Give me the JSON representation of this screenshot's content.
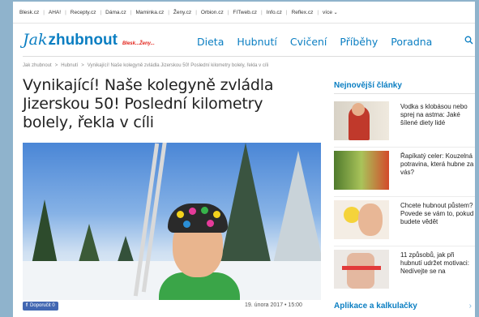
{
  "portal_links": [
    "Blesk.cz",
    "AHA!",
    "Recepty.cz",
    "Dáma.cz",
    "Maminka.cz",
    "Ženy.cz",
    "Orbion.cz",
    "FITweb.cz",
    "Info.cz",
    "Reflex.cz",
    "více"
  ],
  "logo": {
    "jak": "Jak",
    "zhubnout": "zhubnout",
    "tag": "Blesk...Ženy..."
  },
  "nav": [
    "Dieta",
    "Hubnutí",
    "Cvičení",
    "Příběhy",
    "Poradna"
  ],
  "nav_search_icon": "search-icon",
  "breadcrumb": [
    "Jak zhubnout",
    "Hubnutí",
    "Vynikající! Naše kolegyně zvládla Jizerskou 50! Poslední kilometry bolely, řekla v cíli"
  ],
  "breadcrumb_sep": ">",
  "article": {
    "title": "Vynikající! Naše kolegyně zvládla Jizerskou 50! Poslední kilometry bolely, řekla v cíli",
    "date": "19. února 2017 • 15:00",
    "like_label": "Doporučit 0"
  },
  "sidebar": {
    "title": "Nejnovější články",
    "articles": [
      {
        "text": "Vodka s klobásou nebo sprej na astma: Jaké šílené diety lidé"
      },
      {
        "text": "Řapíkatý celer: Kouzelná potravina, která hubne za vás?"
      },
      {
        "text": "Chcete hubnout půstem? Povede se vám to, pokud budete vědět"
      },
      {
        "text": "11 způsobů, jak při hubnutí udržet motivaci: Nedívejte se na"
      }
    ],
    "footer": "Aplikace a kalkulačky",
    "footer_chevron": "›"
  },
  "colors": {
    "brand": "#0a7ec2",
    "accent": "#e2231a",
    "facebook": "#4267b2"
  }
}
